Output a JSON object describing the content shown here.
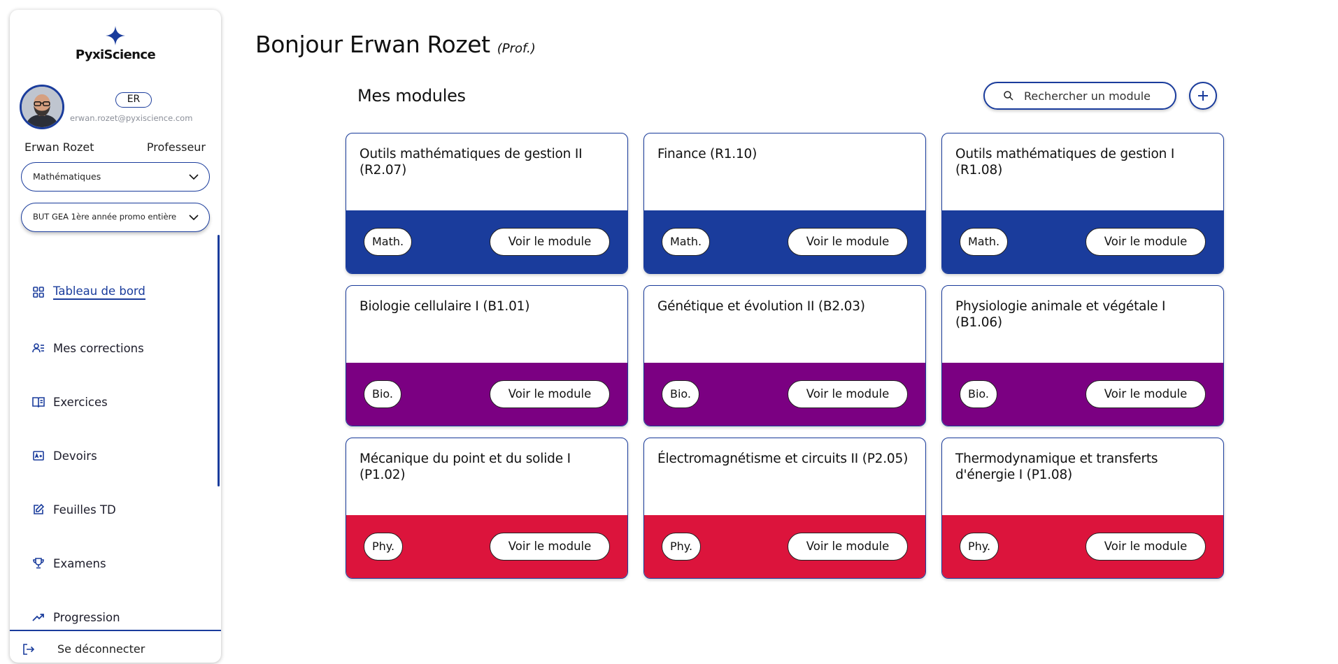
{
  "app": {
    "brand": "PyxiScience"
  },
  "user": {
    "initials": "ER",
    "email": "erwan.rozet@pyxiscience.com",
    "name": "Erwan Rozet",
    "role": "Professeur"
  },
  "filters": {
    "subject": "Mathématiques",
    "group": "BUT GEA 1ère année promo entière"
  },
  "nav": {
    "items": [
      {
        "label": "Tableau de bord",
        "icon": "dashboard-icon",
        "active": true
      },
      {
        "label": "Mes corrections",
        "icon": "corrections-icon"
      },
      {
        "label": "Exercices",
        "icon": "book-icon"
      },
      {
        "label": "Devoirs",
        "icon": "assignment-icon"
      },
      {
        "label": "Feuilles TD",
        "icon": "edit-sheet-icon"
      },
      {
        "label": "Examens",
        "icon": "trophy-icon"
      },
      {
        "label": "Progression",
        "icon": "trend-up-icon"
      }
    ],
    "logout": "Se déconnecter"
  },
  "greeting": {
    "hello": "Bonjour Erwan Rozet",
    "role": "(Prof.)"
  },
  "modules": {
    "title": "Mes modules",
    "search_placeholder": "Rechercher un module",
    "button_label": "Voir le module",
    "colors": {
      "Math.": "#1a3c9c",
      "Bio.": "#7b0082",
      "Phy.": "#dc143c"
    },
    "items": [
      {
        "title": "Outils mathématiques de gestion II (R2.07)",
        "tag": "Math."
      },
      {
        "title": "Finance (R1.10)",
        "tag": "Math."
      },
      {
        "title": "Outils mathématiques de gestion I (R1.08)",
        "tag": "Math."
      },
      {
        "title": "Biologie cellulaire I (B1.01)",
        "tag": "Bio."
      },
      {
        "title": "Génétique et évolution II (B2.03)",
        "tag": "Bio."
      },
      {
        "title": "Physiologie animale et végétale I (B1.06)",
        "tag": "Bio."
      },
      {
        "title": "Mécanique du point et du solide I (P1.02)",
        "tag": "Phy."
      },
      {
        "title": "Électromagnétisme et circuits II (P2.05)",
        "tag": "Phy."
      },
      {
        "title": "Thermodynamique et transferts d'énergie I (P1.08)",
        "tag": "Phy."
      }
    ]
  }
}
